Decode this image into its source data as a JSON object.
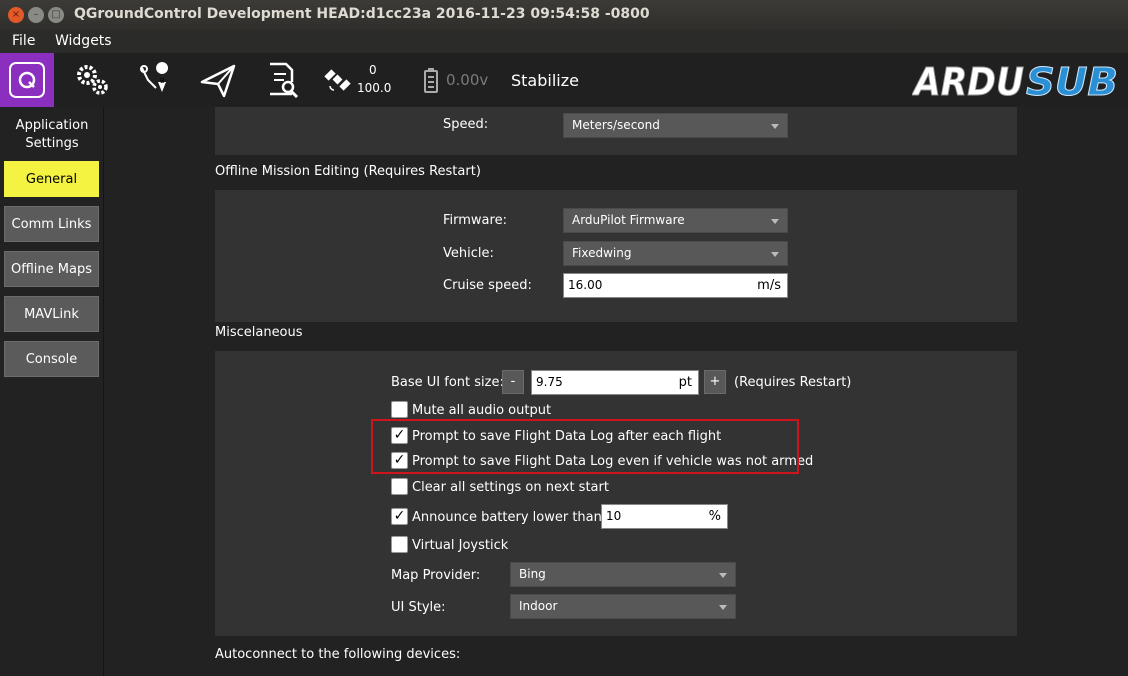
{
  "window": {
    "title": "QGroundControl Development HEAD:d1cc23a 2016-11-23 09:54:58 -0800",
    "close_glyph": "×",
    "min_glyph": "–",
    "max_glyph": "□"
  },
  "menu": {
    "file": "File",
    "widgets": "Widgets"
  },
  "toolbar": {
    "icons": [
      "qgc-logo-icon",
      "settings-gears-icon",
      "plan-waypoint-icon",
      "fly-paper-plane-icon",
      "analyze-document-icon",
      "gps-satellite-icon",
      "battery-icon"
    ],
    "gps_count": "0",
    "gps_hdop": "100.0",
    "voltage": "0.00v",
    "flight_mode": "Stabilize",
    "brand_logo_text": "ARDUSUB",
    "colors": {
      "active_tool": "#8a2fc0",
      "logo_blue": "#2b8fd6"
    }
  },
  "sidebar": {
    "title_line1": "Application",
    "title_line2": "Settings",
    "items": [
      {
        "label": "General",
        "active": true
      },
      {
        "label": "Comm Links",
        "active": false
      },
      {
        "label": "Offline Maps",
        "active": false
      },
      {
        "label": "MAVLink",
        "active": false
      },
      {
        "label": "Console",
        "active": false
      }
    ],
    "active_color": "#f5f342"
  },
  "units_panel": {
    "speed_label": "Speed:",
    "speed_value": "Meters/second"
  },
  "offline_mission": {
    "title": "Offline Mission Editing (Requires Restart)",
    "firmware_label": "Firmware:",
    "firmware_value": "ArduPilot Firmware",
    "vehicle_label": "Vehicle:",
    "vehicle_value": "Fixedwing",
    "cruise_label": "Cruise speed:",
    "cruise_value": "16.00",
    "cruise_unit": "m/s"
  },
  "misc": {
    "title": "Miscelaneous",
    "font_size_label": "Base UI font size:",
    "font_size_minus": "-",
    "font_size_value": "9.75",
    "font_size_unit": "pt",
    "font_size_plus": "+",
    "font_size_note": "(Requires Restart)",
    "mute_label": "Mute all audio output",
    "mute_checked": false,
    "prompt_save_label": "Prompt to save Flight Data Log after each flight",
    "prompt_save_checked": true,
    "prompt_save_unarmed_label": "Prompt to save Flight Data Log even if vehicle was not armed",
    "prompt_save_unarmed_checked": true,
    "clear_settings_label": "Clear all settings on next start",
    "clear_settings_checked": false,
    "battery_label": "Announce battery lower than:",
    "battery_checked": true,
    "battery_value": "10",
    "battery_unit": "%",
    "joystick_label": "Virtual Joystick",
    "joystick_checked": false,
    "map_provider_label": "Map Provider:",
    "map_provider_value": "Bing",
    "ui_style_label": "UI Style:",
    "ui_style_value": "Indoor",
    "check_glyph": "✓"
  },
  "autoconnect": {
    "title": "Autoconnect to the following devices:"
  }
}
